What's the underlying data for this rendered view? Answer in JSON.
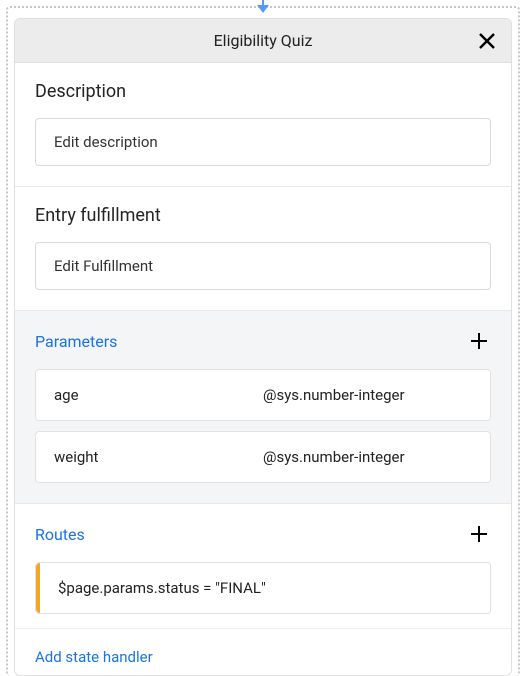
{
  "header": {
    "title": "Eligibility Quiz"
  },
  "description": {
    "title": "Description",
    "field": "Edit description"
  },
  "entryFulfillment": {
    "title": "Entry fulfillment",
    "field": "Edit Fulfillment"
  },
  "parameters": {
    "title": "Parameters",
    "rows": [
      {
        "name": "age",
        "type": "@sys.number-integer"
      },
      {
        "name": "weight",
        "type": "@sys.number-integer"
      }
    ]
  },
  "routes": {
    "title": "Routes",
    "rows": [
      {
        "condition": "$page.params.status = \"FINAL\""
      }
    ]
  },
  "addHandler": {
    "label": "Add state handler"
  }
}
